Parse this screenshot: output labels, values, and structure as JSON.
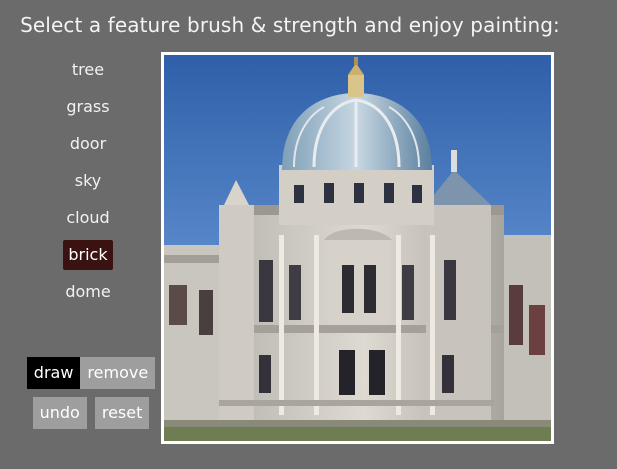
{
  "header": {
    "title": "Select a feature brush & strength and enjoy painting:"
  },
  "brushes": [
    {
      "label": "tree",
      "selected": false
    },
    {
      "label": "grass",
      "selected": false
    },
    {
      "label": "door",
      "selected": false
    },
    {
      "label": "sky",
      "selected": false
    },
    {
      "label": "cloud",
      "selected": false
    },
    {
      "label": "brick",
      "selected": true
    },
    {
      "label": "dome",
      "selected": false
    }
  ],
  "tools": {
    "draw_label": "draw",
    "remove_label": "remove",
    "undo_label": "undo",
    "reset_label": "reset",
    "active": "draw"
  },
  "colors": {
    "background": "#6b6b6b",
    "selected_brush": "#3a1212",
    "tool_button": "#9e9e9e",
    "active_tool": "#000000"
  }
}
